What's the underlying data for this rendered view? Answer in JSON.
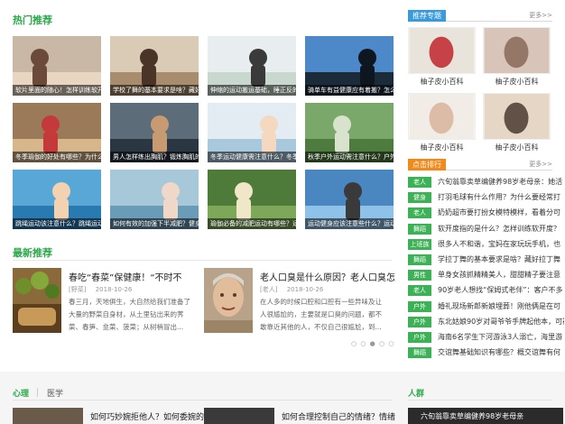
{
  "hot": {
    "title": "热门推荐",
    "items": [
      {
        "caption": "软片里面的随心！怎样训练软开"
      },
      {
        "caption": "学校了舞的基本要求是啥？藏好打了"
      },
      {
        "caption": "伸缩的运动搬运基础，睡正反的运"
      },
      {
        "caption": "骑单车有益健康应有着搬？怎么骑单车"
      },
      {
        "caption": "冬季瑜伽的好处有哪些？为什么冬季"
      },
      {
        "caption": "男人怎样练出胸肌？锻炼胸肌的方"
      },
      {
        "caption": "冬季运动健康需注意什么？冬季运动"
      },
      {
        "caption": "秋季户外运动需注意什么？户外运动"
      },
      {
        "caption": "跳绳运动该注意什么？跳绳运动有什"
      },
      {
        "caption": "如何有效的加强下半减肥？健身球怎"
      },
      {
        "caption": "瑜伽必备的减肥运动有哪些？适合瑜"
      },
      {
        "caption": "运动健身应该注意些什么？运动健"
      }
    ]
  },
  "topics": {
    "title": "推荐专题",
    "more": "更多>>",
    "items": [
      {
        "name": "柚子皮小百科"
      },
      {
        "name": "柚子皮小百科"
      },
      {
        "name": "柚子皮小百科"
      },
      {
        "name": "柚子皮小百科"
      }
    ]
  },
  "ranking": {
    "title": "点击排行",
    "more": "更多>>",
    "items": [
      {
        "tag": "老人",
        "text": "六旬翁靠卖草编健养98岁老母亲：她活"
      },
      {
        "tag": "健身",
        "text": "打羽毛球有什么作用？为什么要经常打"
      },
      {
        "tag": "老人",
        "text": "奶奶超市要打扮女模特模样，看着分可"
      },
      {
        "tag": "舞蹈",
        "text": "软开度指的是什么？怎样训练软开度？"
      },
      {
        "tag": "上班族",
        "text": "很多人不和谐，宝妈在家玩玩手机，也"
      },
      {
        "tag": "舞蹈",
        "text": "学拉丁舞的基本要求是啥？藏好拉丁舞"
      },
      {
        "tag": "男性",
        "text": "单身女孩抓精精美人，甜甜精子要注意"
      },
      {
        "tag": "老人",
        "text": "90岁老人想找“保姆式老伴”：客户不多"
      },
      {
        "tag": "户外",
        "text": "婚礼现场新郎新娘埋葬！刚他俩是在可"
      },
      {
        "tag": "户外",
        "text": "东北姑娘90岁对哥爷爷手牌起他本，可被多"
      },
      {
        "tag": "户外",
        "text": "海南6名学生下河游泳3人溺亡，海里游"
      },
      {
        "tag": "舞蹈",
        "text": "交谊舞基础知识有哪些？概交谊舞有何"
      }
    ]
  },
  "newest": {
    "title": "最新推荐",
    "items": [
      {
        "title": "春吃“春菜”保健康！“不时不",
        "source": "[野菜]",
        "date": "2018-10-26",
        "body": "春三月，天地俱生，大自然给我们准备了大量的野菜自身材，从土里钻出来的荠菜、春笋、韭菜、菠菜；从树梢冒出..."
      },
      {
        "title": "老人口臭是什么原因？老人口臭怎",
        "source": "[老人]",
        "date": "2018-10-26",
        "body": "在人多的时候口腔和口腔有一些异味及让人很尴尬的，主要就是口臭的问题，都不敢靠近其他的人，不仅自己很尴尬，到..."
      }
    ],
    "pager": "○ ○ ● ○ ○"
  },
  "footer": {
    "tab1": "心理",
    "tab2": "医学",
    "right_title": "人群",
    "item1": "如何巧妙婉拒他人？如何委婉的",
    "item2": "如何合理控制自己的情绪？情绪",
    "item3": "六旬翁靠卖草编健养98岁老母亲"
  },
  "colors": {
    "accent_green": "#2aa84a",
    "topic_tab": "#3a9bdc",
    "rank_tab": "#f08a1c",
    "tag_bg": "#3cb156"
  }
}
